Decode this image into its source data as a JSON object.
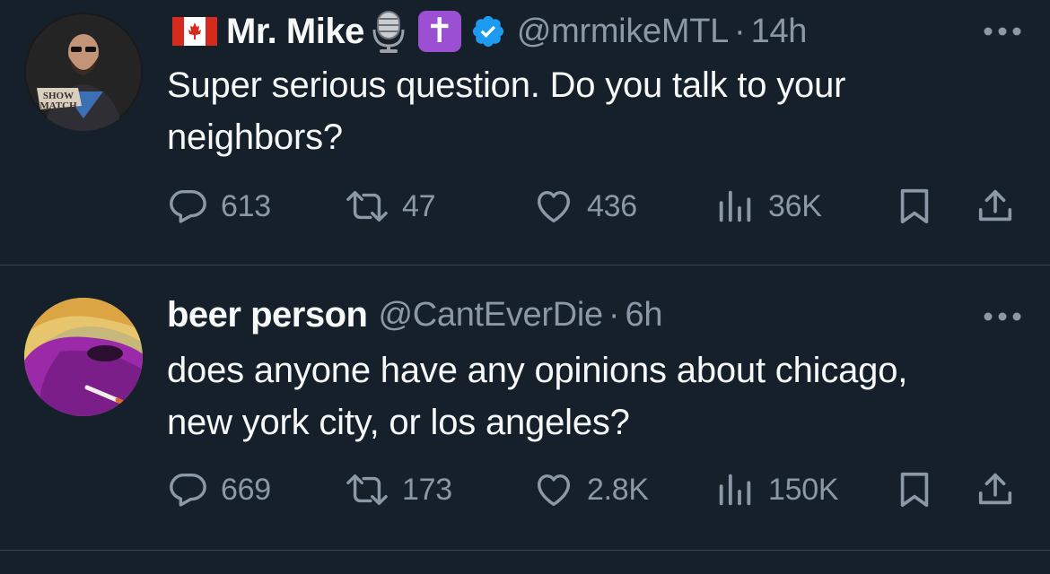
{
  "tweets": [
    {
      "display_name": "Mr. Mike",
      "handle": "@mrmikeMTL",
      "separator": "·",
      "time": "14h",
      "text": "Super serious question. Do you talk to your\nneighbors?",
      "avatar_text": "SHOW\nMATCH",
      "badges": [
        "canada-flag",
        "microphone",
        "latin-cross",
        "verified-check"
      ],
      "stats": {
        "replies": "613",
        "retweets": "47",
        "likes": "436",
        "views": "36K"
      }
    },
    {
      "display_name": "beer person",
      "handle": "@CantEverDie",
      "separator": "·",
      "time": "6h",
      "text": "does anyone have any opinions about chicago,\nnew york city, or los angeles?",
      "stats": {
        "replies": "669",
        "retweets": "173",
        "likes": "2.8K",
        "views": "150K"
      }
    }
  ],
  "colors": {
    "background": "#15202b",
    "primary_text": "#f7f9f9",
    "secondary_text": "#8b98a5",
    "divider": "#38444d",
    "verified": "#1d9bf0",
    "emoji_purple": "#9b4fd2"
  }
}
